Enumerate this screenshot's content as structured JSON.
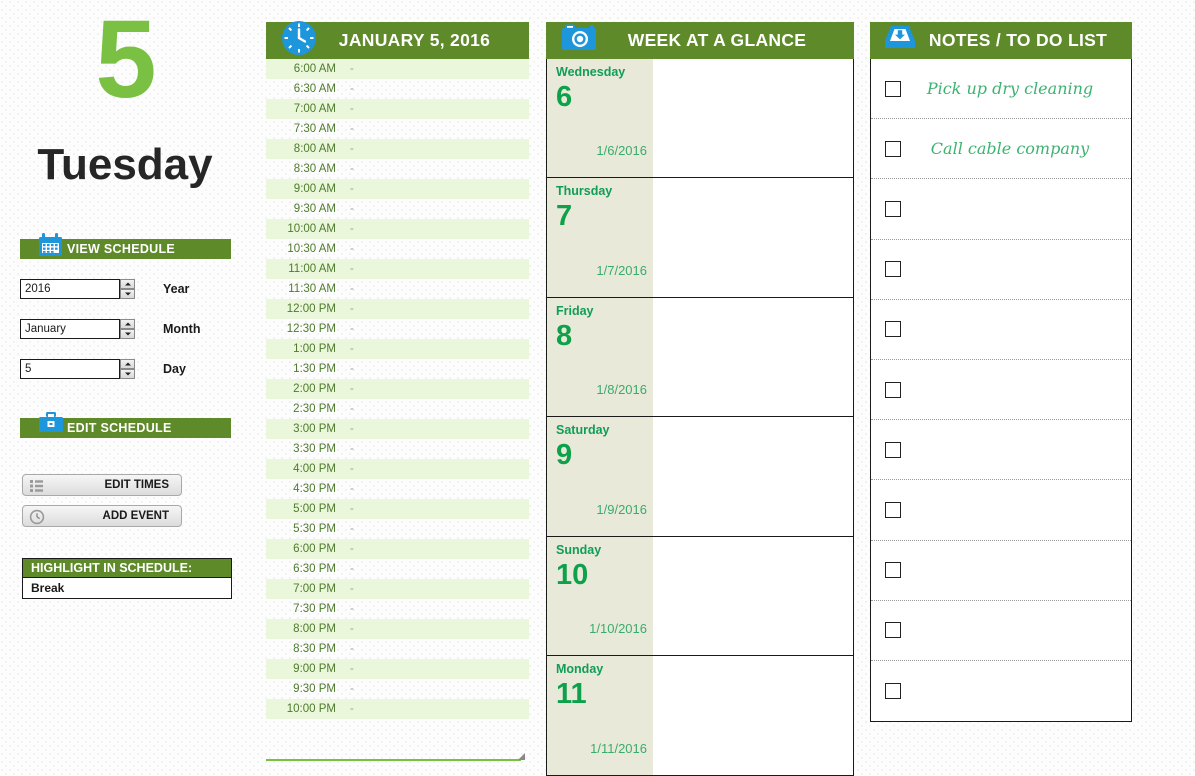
{
  "sidebar": {
    "day_number": "5",
    "day_name": "Tuesday",
    "view_schedule": {
      "label": "VIEW SCHEDULE",
      "icon": "calendar-icon"
    },
    "fields": [
      {
        "value": "2016",
        "label": "Year"
      },
      {
        "value": "January",
        "label": "Month"
      },
      {
        "value": "5",
        "label": "Day"
      }
    ],
    "edit_schedule": {
      "label": "EDIT SCHEDULE",
      "icon": "toolbox-icon"
    },
    "buttons": [
      {
        "label": "EDIT TIMES",
        "icon": "list-icon"
      },
      {
        "label": "ADD EVENT",
        "icon": "clock-icon"
      }
    ],
    "highlight": {
      "title": "HIGHLIGHT IN SCHEDULE:",
      "value": "Break"
    }
  },
  "schedule": {
    "icon": "clock-icon",
    "title": "JANUARY 5, 2016",
    "rows": [
      {
        "time": "6:00 AM",
        "event": "-"
      },
      {
        "time": "6:30 AM",
        "event": "-"
      },
      {
        "time": "7:00 AM",
        "event": "-"
      },
      {
        "time": "7:30 AM",
        "event": "-"
      },
      {
        "time": "8:00 AM",
        "event": "-"
      },
      {
        "time": "8:30 AM",
        "event": "-"
      },
      {
        "time": "9:00 AM",
        "event": "-"
      },
      {
        "time": "9:30 AM",
        "event": "-"
      },
      {
        "time": "10:00 AM",
        "event": "-"
      },
      {
        "time": "10:30 AM",
        "event": "-"
      },
      {
        "time": "11:00 AM",
        "event": "-"
      },
      {
        "time": "11:30 AM",
        "event": "-"
      },
      {
        "time": "12:00 PM",
        "event": "-"
      },
      {
        "time": "12:30 PM",
        "event": "-"
      },
      {
        "time": "1:00 PM",
        "event": "-"
      },
      {
        "time": "1:30 PM",
        "event": "-"
      },
      {
        "time": "2:00 PM",
        "event": "-"
      },
      {
        "time": "2:30 PM",
        "event": "-"
      },
      {
        "time": "3:00 PM",
        "event": "-"
      },
      {
        "time": "3:30 PM",
        "event": "-"
      },
      {
        "time": "4:00 PM",
        "event": "-"
      },
      {
        "time": "4:30 PM",
        "event": "-"
      },
      {
        "time": "5:00 PM",
        "event": "-"
      },
      {
        "time": "5:30 PM",
        "event": "-"
      },
      {
        "time": "6:00 PM",
        "event": "-"
      },
      {
        "time": "6:30 PM",
        "event": "-"
      },
      {
        "time": "7:00 PM",
        "event": "-"
      },
      {
        "time": "7:30 PM",
        "event": "-"
      },
      {
        "time": "8:00 PM",
        "event": "-"
      },
      {
        "time": "8:30 PM",
        "event": "-"
      },
      {
        "time": "9:00 PM",
        "event": "-"
      },
      {
        "time": "9:30 PM",
        "event": "-"
      },
      {
        "time": "10:00 PM",
        "event": "-"
      }
    ]
  },
  "week": {
    "icon": "camera-icon",
    "title": "WEEK AT A GLANCE",
    "days": [
      {
        "name": "Wednesday",
        "number": "6",
        "date": "1/6/2016",
        "note": ""
      },
      {
        "name": "Thursday",
        "number": "7",
        "date": "1/7/2016",
        "note": ""
      },
      {
        "name": "Friday",
        "number": "8",
        "date": "1/8/2016",
        "note": ""
      },
      {
        "name": "Saturday",
        "number": "9",
        "date": "1/9/2016",
        "note": ""
      },
      {
        "name": "Sunday",
        "number": "10",
        "date": "1/10/2016",
        "note": ""
      },
      {
        "name": "Monday",
        "number": "11",
        "date": "1/11/2016",
        "note": ""
      }
    ]
  },
  "notes": {
    "icon": "inbox-icon",
    "title": "NOTES / TO DO LIST",
    "items": [
      {
        "text": "Pick up dry cleaning",
        "checked": false
      },
      {
        "text": "Call cable company",
        "checked": false
      },
      {
        "text": "",
        "checked": false
      },
      {
        "text": "",
        "checked": false
      },
      {
        "text": "",
        "checked": false
      },
      {
        "text": "",
        "checked": false
      },
      {
        "text": "",
        "checked": false
      },
      {
        "text": "",
        "checked": false
      },
      {
        "text": "",
        "checked": false
      },
      {
        "text": "",
        "checked": false
      },
      {
        "text": "",
        "checked": false
      }
    ]
  },
  "colors": {
    "header_green": "#5f8a2a",
    "bright_green": "#7ac143",
    "row_green": "#eaf7da",
    "week_beige": "#e9e9d9",
    "icon_blue": "#1e96db",
    "note_green": "#3cb371"
  }
}
